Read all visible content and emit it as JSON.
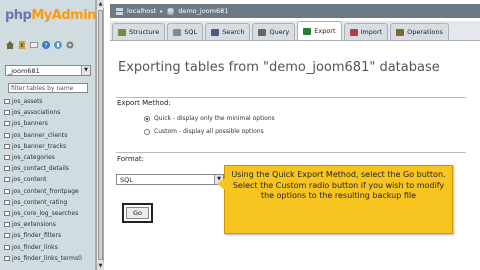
{
  "logo": {
    "part1": "php",
    "part2": "MyAdmin"
  },
  "nav_icons": [
    "home-icon",
    "exit-icon",
    "query-icon",
    "help-icon",
    "docs-icon",
    "settings-icon"
  ],
  "db_select": {
    "value": "_joom681"
  },
  "filter": {
    "placeholder": "filter tables by name"
  },
  "tables": [
    "jos_assets",
    "jos_associations",
    "jos_banners",
    "jos_banner_clients",
    "jos_banner_tracks",
    "jos_categories",
    "jos_contact_details",
    "jos_content",
    "jos_content_frontpage",
    "jos_content_rating",
    "jos_core_log_searches",
    "jos_extensions",
    "jos_finder_filters",
    "jos_finder_links",
    "jos_finder_links_terms0"
  ],
  "breadcrumb": {
    "server": "localhost",
    "database": "demo_joom681"
  },
  "tabs": [
    {
      "label": "Structure",
      "icon": "structure-icon",
      "active": false
    },
    {
      "label": "SQL",
      "icon": "sql-icon",
      "active": false
    },
    {
      "label": "Search",
      "icon": "search-icon",
      "active": false
    },
    {
      "label": "Query",
      "icon": "query-icon",
      "active": false
    },
    {
      "label": "Export",
      "icon": "export-icon",
      "active": true
    },
    {
      "label": "Import",
      "icon": "import-icon",
      "active": false
    },
    {
      "label": "Operations",
      "icon": "operations-icon",
      "active": false
    }
  ],
  "main": {
    "title": "Exporting tables from \"demo_joom681\" database",
    "export_method_label": "Export Method:",
    "quick_option": "Quick - display only the minimal options",
    "custom_option": "Custom - display all possible options",
    "format_label": "Format:",
    "format_value": "SQL",
    "go_label": "Go"
  },
  "callout": {
    "text": "Using the Quick Export Method, select the Go button. Select the Custom radio button if you wish to modify the options to the resulting backup file"
  },
  "colors": {
    "accent": "#f8c41f",
    "breadcrumb_bg": "#6c7a86",
    "nav_bg": "#d0dce0"
  }
}
